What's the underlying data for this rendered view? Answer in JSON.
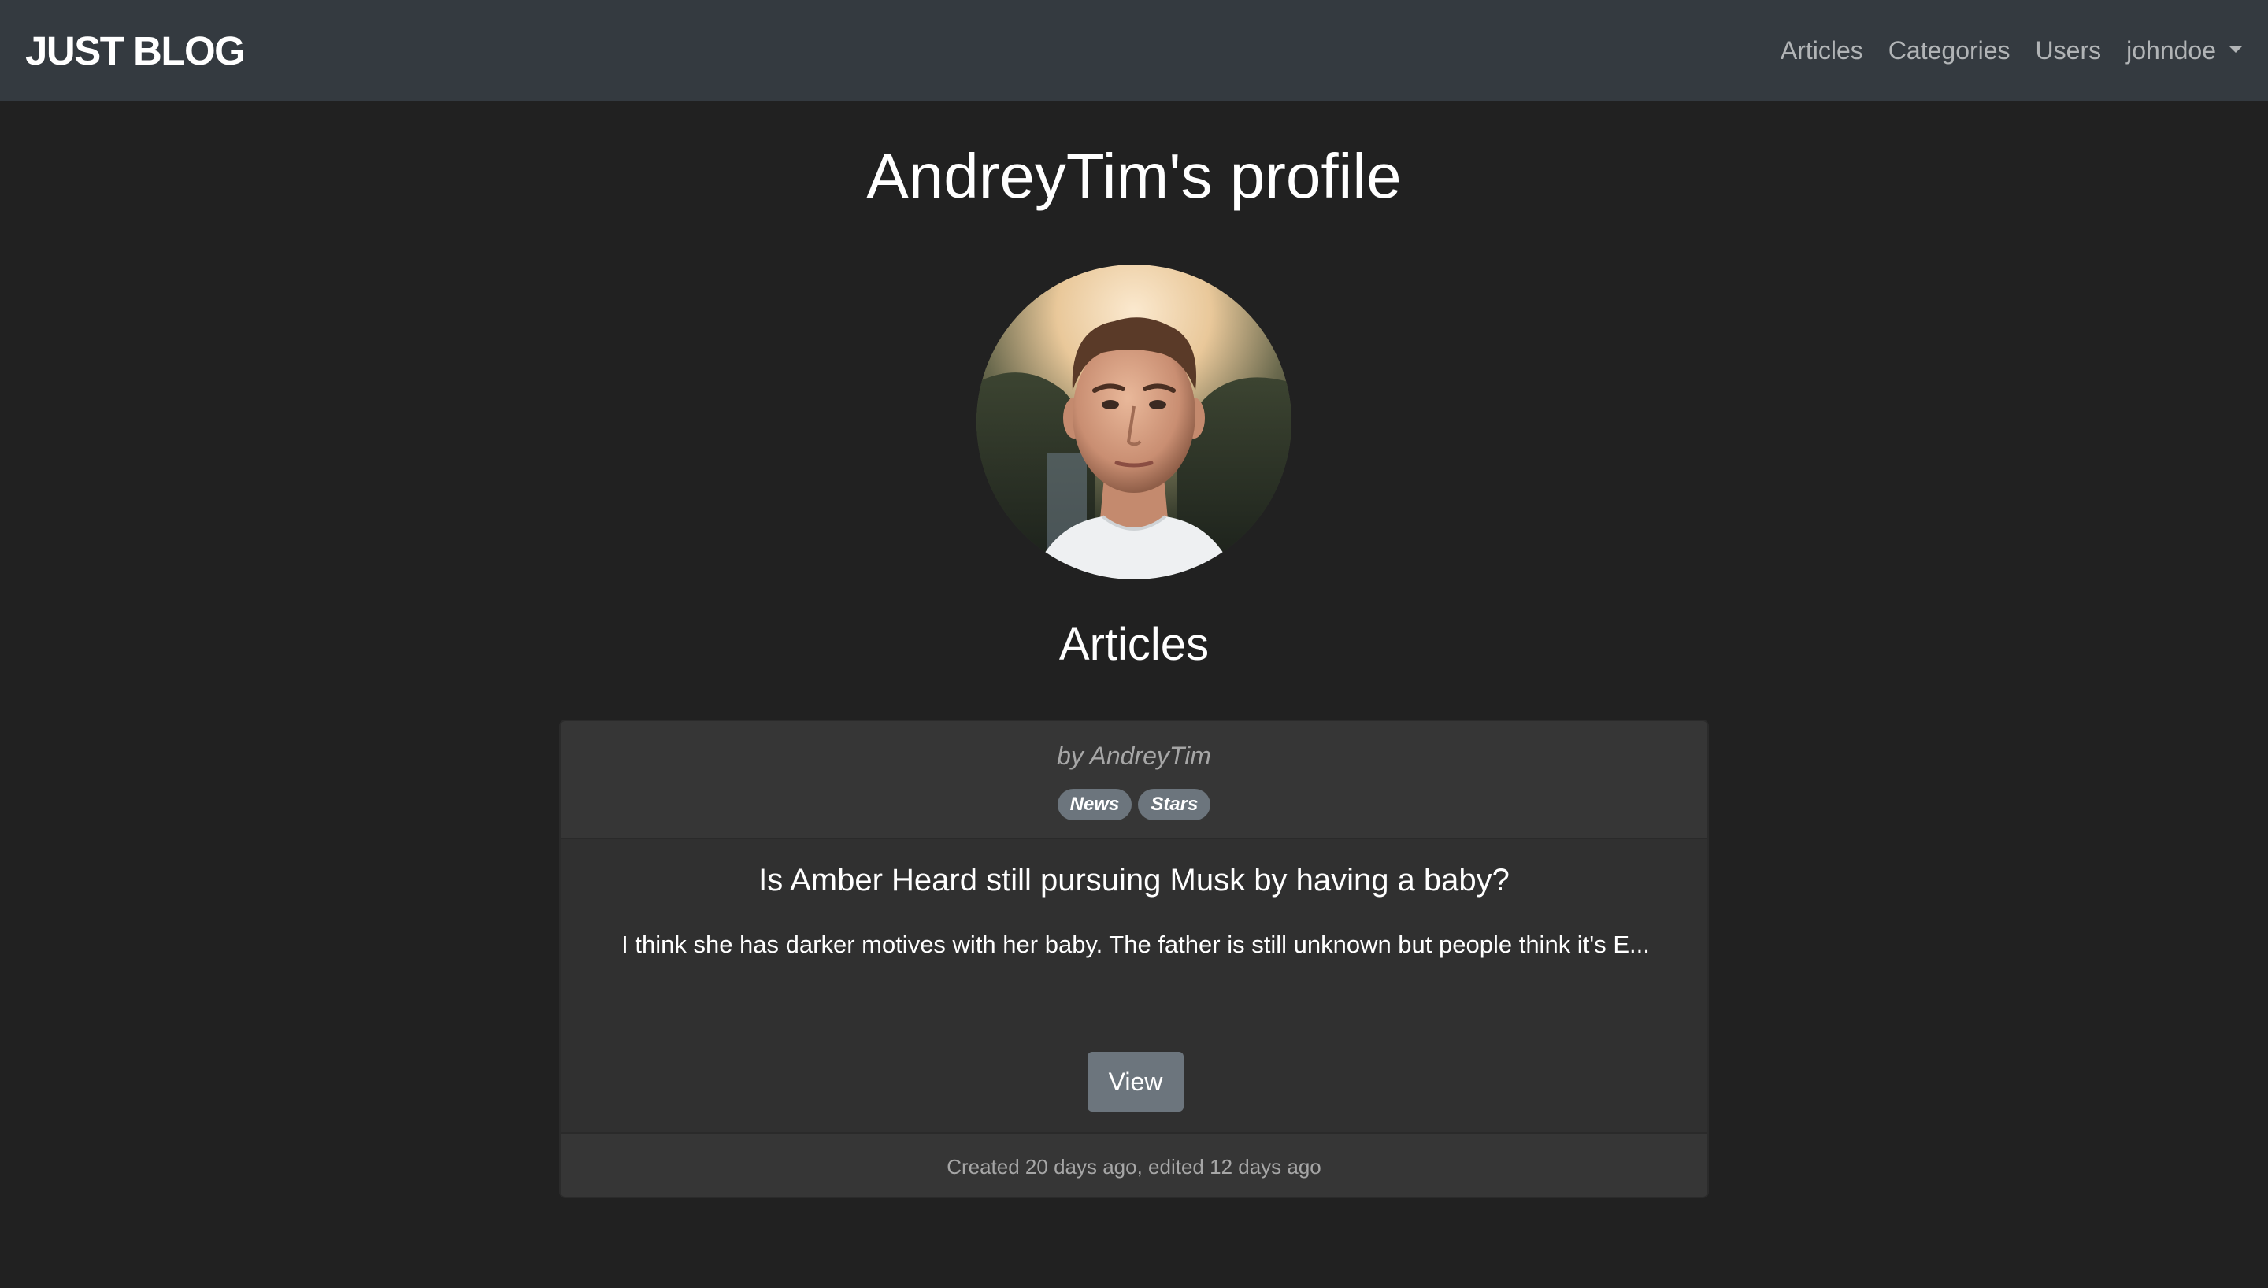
{
  "navbar": {
    "brand": "JUST BLOG",
    "links": [
      {
        "label": "Articles"
      },
      {
        "label": "Categories"
      },
      {
        "label": "Users"
      }
    ],
    "user_menu": "johndoe"
  },
  "profile": {
    "title": "AndreyTim's profile",
    "avatar_alt": "profile photo"
  },
  "articles_section": {
    "heading": "Articles"
  },
  "article": {
    "author": "by AndreyTim",
    "tags": [
      "News",
      "Stars"
    ],
    "title": "Is Amber Heard still pursuing Musk by having a baby?",
    "excerpt": "I think she has darker motives with her baby. The father is still unknown but people think it's E...",
    "view_label": "View",
    "footer": "Created 20 days ago, edited 12 days ago"
  },
  "colors": {
    "page_bg": "#212121",
    "navbar_bg": "#343a40",
    "card_bg": "#303030",
    "badge_bg": "#6c757d",
    "button_bg": "#6c757d"
  }
}
